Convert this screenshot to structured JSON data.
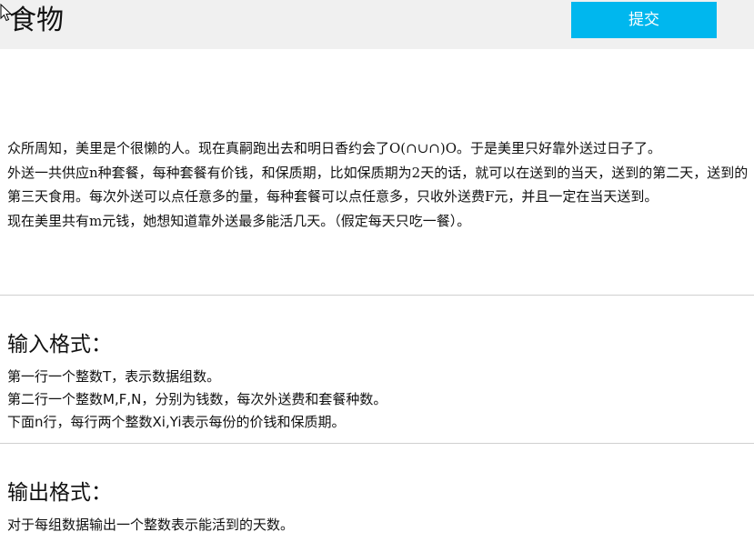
{
  "header": {
    "title": "食物",
    "submit_label": "提交"
  },
  "problem": {
    "description": [
      "众所周知，美里是个很懒的人。现在真嗣跑出去和明日香约会了O(∩∪∩)O。于是美里只好靠外送过日子了。",
      "外送一共供应n种套餐，每种套餐有价钱，和保质期，比如保质期为2天的话，就可以在送到的当天，送到的第二天，送到的第三天食用。每次外送可以点任意多的量，每种套餐可以点任意多，只收外送费F元，并且一定在当天送到。",
      "现在美里共有m元钱，她想知道靠外送最多能活几天。（假定每天只吃一餐）。"
    ],
    "input_heading": "输入格式：",
    "input_lines": [
      "第一行一个整数T，表示数据组数。",
      "第二行一个整数M,F,N，分别为钱数，每次外送费和套餐种数。",
      "下面n行，每行两个整数Xi,Yi表示每份的价钱和保质期。"
    ],
    "output_heading": "输出格式：",
    "output_lines": [
      "对于每组数据输出一个整数表示能活到的天数。"
    ]
  }
}
